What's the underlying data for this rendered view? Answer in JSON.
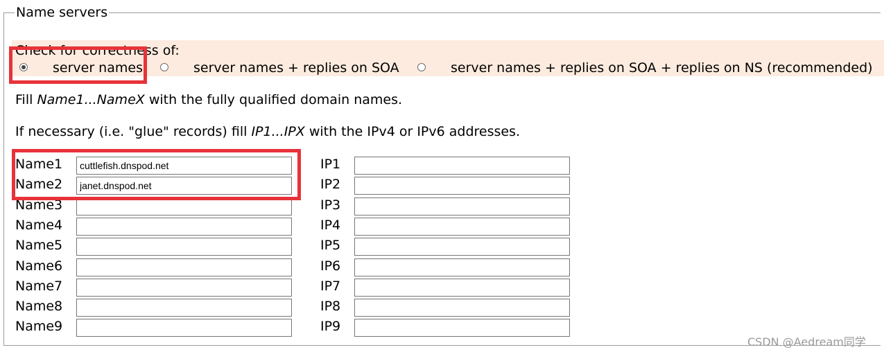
{
  "legend": "Name servers",
  "check": {
    "label": "Check for correctness of:",
    "options": [
      {
        "label": "server names",
        "checked": true
      },
      {
        "label": "server names + replies on SOA",
        "checked": false
      },
      {
        "label": "server names + replies on SOA + replies on NS (recommended)",
        "checked": false
      }
    ]
  },
  "instructions": {
    "fill_prefix": "Fill ",
    "fill_names": "Name1...NameX",
    "fill_suffix": " with the fully qualified domain names.",
    "glue_prefix": "If necessary (i.e. \"glue\" records) fill ",
    "glue_ips": "IP1...IPX",
    "glue_suffix": " with the IPv4 or IPv6 addresses."
  },
  "rows": [
    {
      "name_label": "Name1",
      "name_value": "cuttlefish.dnspod.net",
      "ip_label": "IP1",
      "ip_value": ""
    },
    {
      "name_label": "Name2",
      "name_value": "janet.dnspod.net",
      "ip_label": "IP2",
      "ip_value": ""
    },
    {
      "name_label": "Name3",
      "name_value": "",
      "ip_label": "IP3",
      "ip_value": ""
    },
    {
      "name_label": "Name4",
      "name_value": "",
      "ip_label": "IP4",
      "ip_value": ""
    },
    {
      "name_label": "Name5",
      "name_value": "",
      "ip_label": "IP5",
      "ip_value": ""
    },
    {
      "name_label": "Name6",
      "name_value": "",
      "ip_label": "IP6",
      "ip_value": ""
    },
    {
      "name_label": "Name7",
      "name_value": "",
      "ip_label": "IP7",
      "ip_value": ""
    },
    {
      "name_label": "Name8",
      "name_value": "",
      "ip_label": "IP8",
      "ip_value": ""
    },
    {
      "name_label": "Name9",
      "name_value": "",
      "ip_label": "IP9",
      "ip_value": ""
    }
  ],
  "watermark": "CSDN @Aedream同学",
  "colors": {
    "highlight": "#e8323a",
    "band": "#fdebdf"
  }
}
